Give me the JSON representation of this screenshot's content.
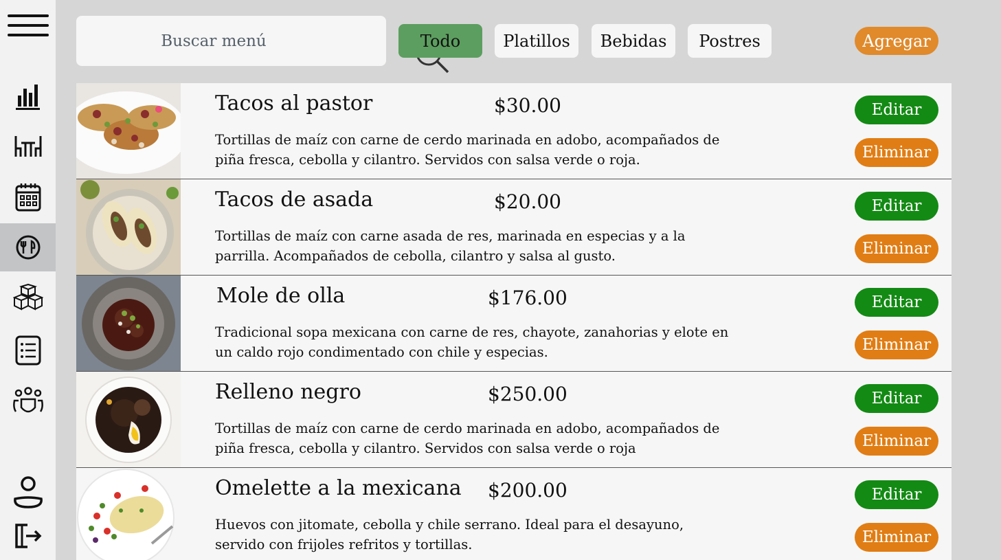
{
  "sidebar": {
    "items": [
      {
        "name": "menu-icon"
      },
      {
        "name": "bar-chart-icon"
      },
      {
        "name": "dining-table-icon"
      },
      {
        "name": "calendar-icon"
      },
      {
        "name": "fork-knife-icon",
        "active": true
      },
      {
        "name": "boxes-icon"
      },
      {
        "name": "checklist-icon"
      },
      {
        "name": "team-icon"
      },
      {
        "name": "user-icon"
      },
      {
        "name": "logout-icon"
      }
    ]
  },
  "search": {
    "placeholder": "Buscar menú",
    "value": ""
  },
  "filters": [
    "Todo",
    "Platillos",
    "Bebidas",
    "Postres"
  ],
  "active_filter": "Todo",
  "add_label": "Agregar",
  "colors": {
    "active_filter": "#5c9e5f",
    "edit": "#138a14",
    "delete": "#e07d14",
    "add": "#e08a2c"
  },
  "items": [
    {
      "name": "Tacos al pastor",
      "price": "$30.00",
      "description": "Tortillas de maíz con carne de cerdo marinada en adobo, acompañados de piña fresca, cebolla y cilantro. Servidos con salsa verde o roja.",
      "edit_label": "Editar",
      "delete_label": "Eliminar"
    },
    {
      "name": "Tacos de asada",
      "price": "$20.00",
      "description": "Tortillas de maíz con carne asada de res, marinada en especias y a la parrilla. Acompañados de cebolla, cilantro y salsa al gusto.",
      "edit_label": "Editar",
      "delete_label": "Eliminar"
    },
    {
      "name": "Mole de olla",
      "price": "$176.00",
      "description": "Tradicional sopa mexicana con carne de res, chayote, zanahorias y elote en un caldo rojo condimentado con chile y especias.",
      "edit_label": "Editar",
      "delete_label": "Eliminar"
    },
    {
      "name": "Relleno negro",
      "price": "$250.00",
      "description": "Tortillas de maíz con carne de cerdo marinada en adobo, acompañados de piña fresca, cebolla y cilantro. Servidos con salsa verde o roja",
      "edit_label": "Editar",
      "delete_label": "Eliminar"
    },
    {
      "name": "Omelette a la mexicana",
      "price": "$200.00",
      "description": "Huevos con jitomate, cebolla y chile serrano. Ideal para el desayuno, servido con frijoles refritos y tortillas.",
      "edit_label": "Editar",
      "delete_label": "Eliminar"
    }
  ]
}
